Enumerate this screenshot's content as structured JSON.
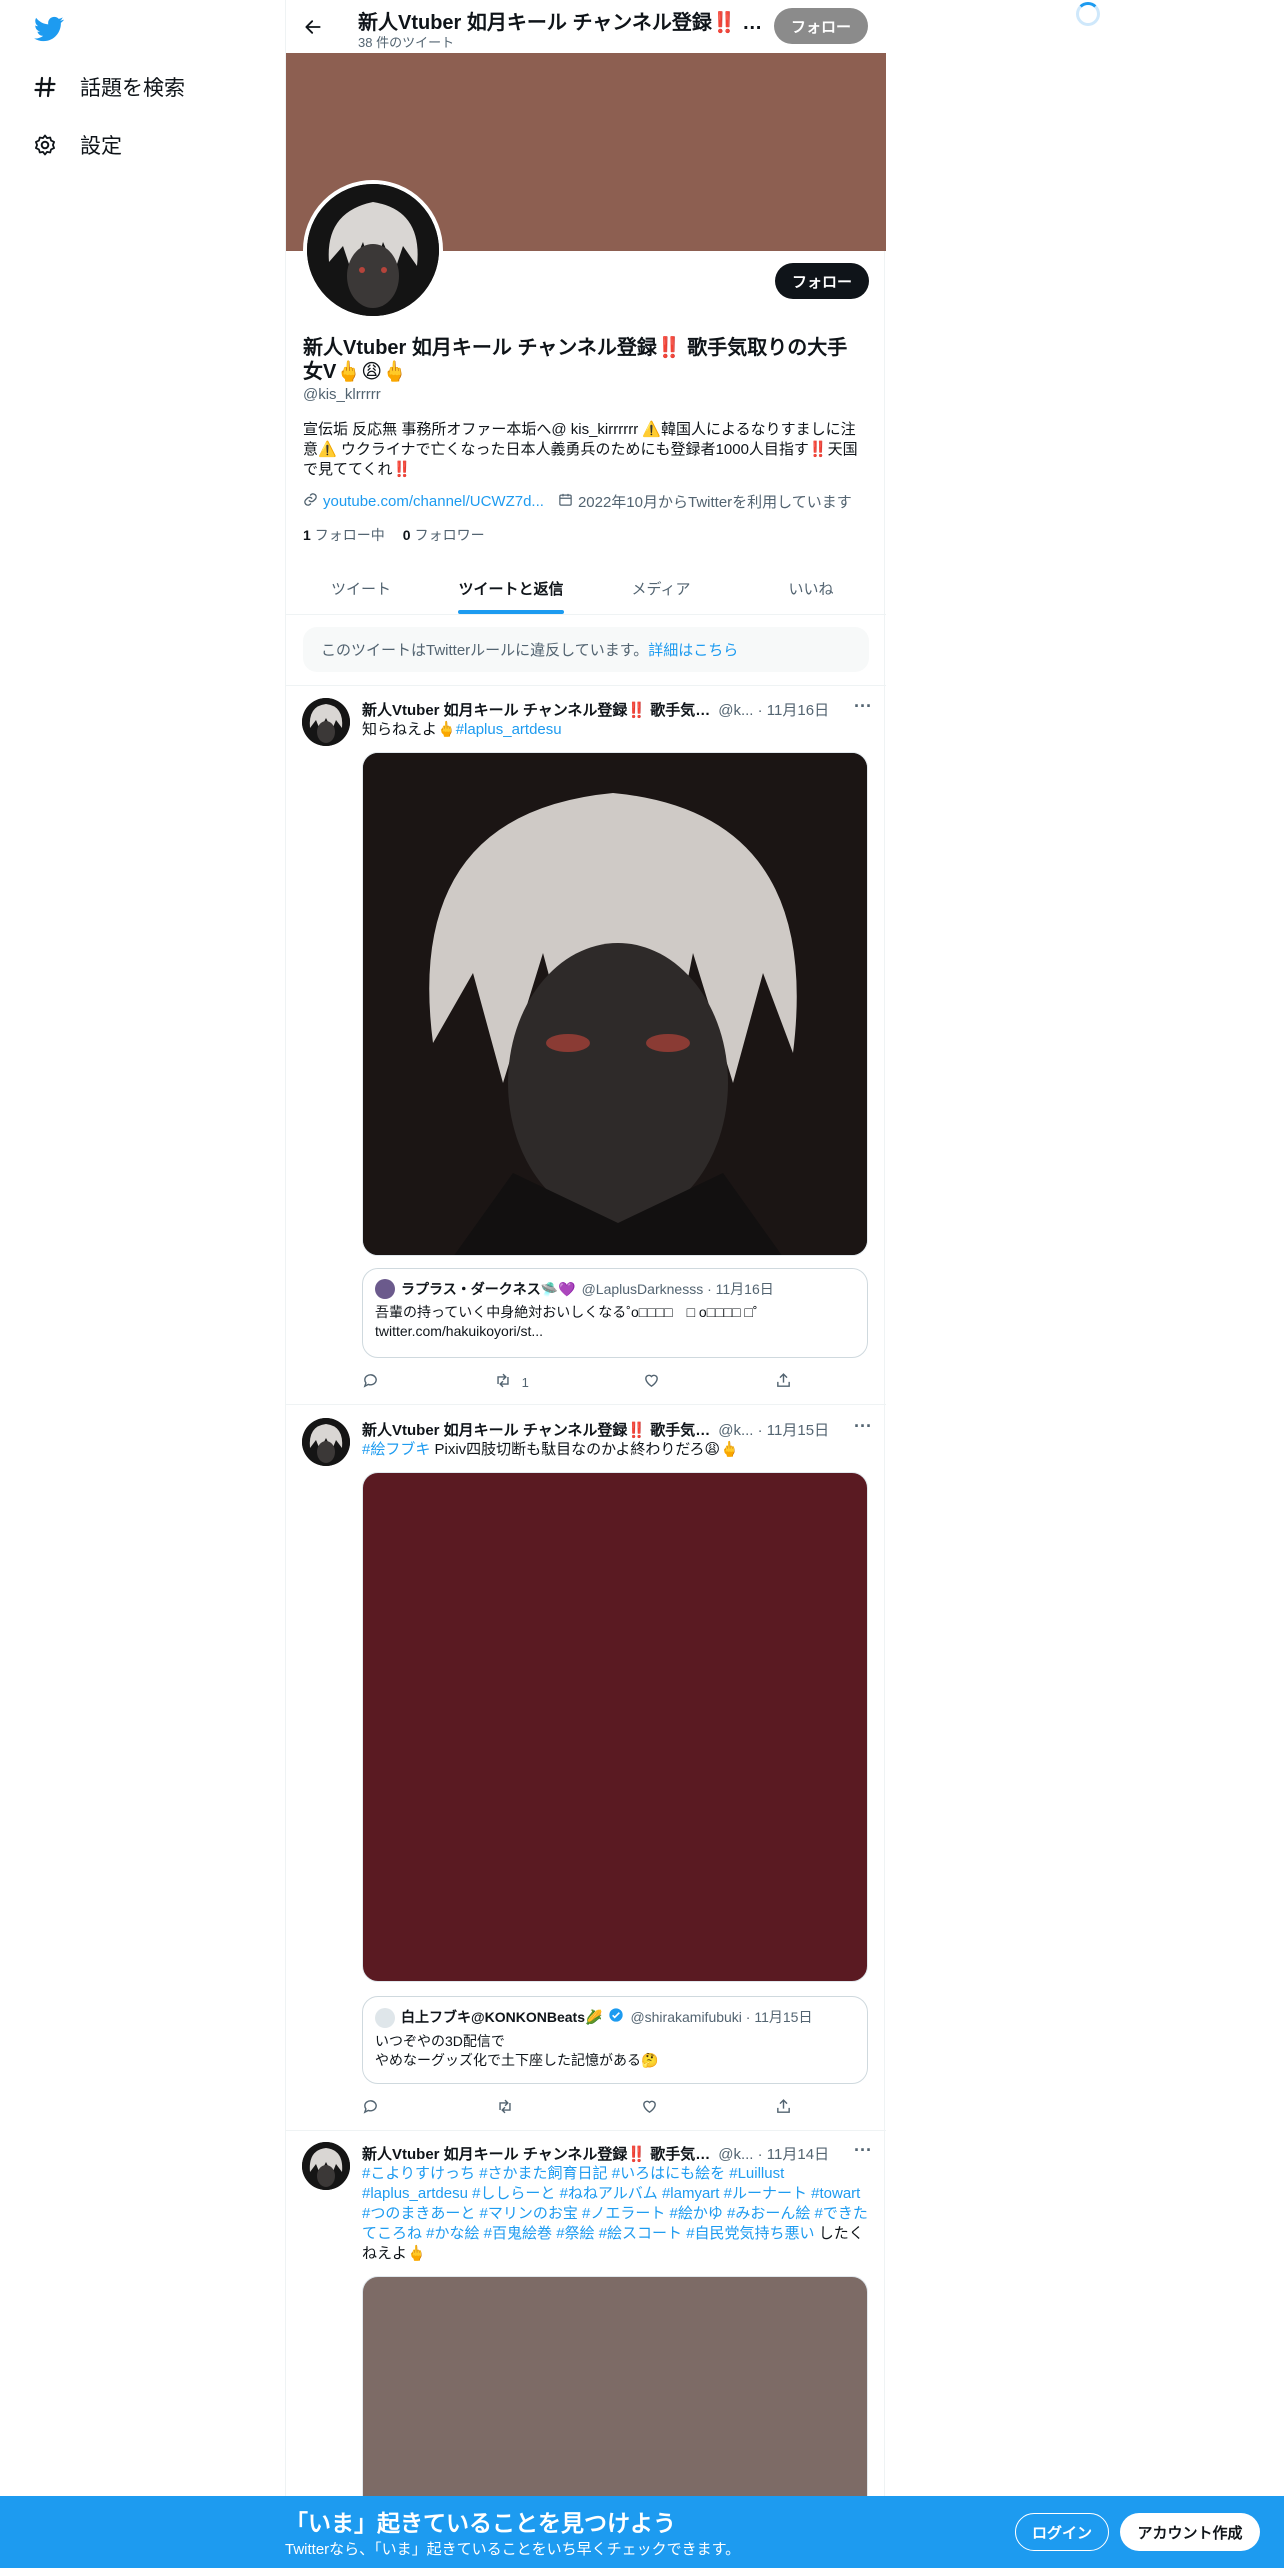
{
  "nav": {
    "items": [
      {
        "label": "話題を検索",
        "icon": "hashtag-icon"
      },
      {
        "label": "設定",
        "icon": "gear-icon"
      }
    ]
  },
  "header": {
    "title": "新人Vtuber 如月キール チャンネル登録‼️ …",
    "tweet_count": "38 件のツイート",
    "follow_label": "フォロー"
  },
  "profile": {
    "name": "新人Vtuber 如月キール チャンネル登録‼️ 歌手気取りの大手女V🖕😩🖕",
    "handle": "@kis_klrrrrr",
    "bio": "宣伝垢 反応無 事務所オファー本垢へ@ kis_kirrrrrr ⚠️韓国人によるなりすましに注意⚠️ ウクライナで亡くなった日本人義勇兵のためにも登録者1000人目指す‼️天国で見ててくれ‼️",
    "link": "youtube.com/channel/UCWZ7d...",
    "joined": "2022年10月からTwitterを利用しています",
    "following_count": "1",
    "following_label": "フォロー中",
    "followers_count": "0",
    "followers_label": "フォロワー",
    "follow_label": "フォロー"
  },
  "tabs": [
    "ツイート",
    "ツイートと返信",
    "メディア",
    "いいね"
  ],
  "notice": {
    "text": "このツイートはTwitterルールに違反しています。",
    "link": "詳細はこちら"
  },
  "tweets": [
    {
      "name": "新人Vtuber 如月キール チャンネル登録‼️ 歌手気…",
      "meta": "@k... · 11月16日",
      "text": "知らねえよ🖕",
      "tag": "#laplus_artdesu",
      "media_color": "#1b1514",
      "quote": {
        "name": "ラプラス・ダークネス🛸💜",
        "meta": "@LaplusDarknesss · 11月16日",
        "line1": "吾輩の持っていく中身絶対おいしくなる˚o□□□□　□ o□□□□ □˚",
        "line2": "twitter.com/hakuikoyori/st..."
      },
      "retweets": "1"
    },
    {
      "name": "新人Vtuber 如月キール チャンネル登録‼️ 歌手気…",
      "meta": "@k... · 11月15日",
      "tag": "#絵フブキ",
      "text": " Pixiv四肢切断も駄目なのかよ終わりだろ😩🖕",
      "media_color": "#5a1a22",
      "quote": {
        "name": "白上フブキ@KONKONBeats🌽",
        "meta": "@shirakamifubuki · 11月15日",
        "line1": "いつぞやの3D配信で",
        "line2": "やめなーグッズ化で土下座した記憶がある🤔"
      },
      "retweets": ""
    },
    {
      "name": "新人Vtuber 如月キール チャンネル登録‼️ 歌手気…",
      "meta": "@k... · 11月14日",
      "tags": "#こよりすけっち #さかまた飼育日記 #いろはにも絵を #Luillust #laplus_artdesu #ししらーと #ねねアルバム #lamyart #ルーナート #towart #つのまきあーと #マリンのお宝 #ノエラート #絵かゆ #みおーん絵 #できたてころね #かな絵 #百鬼絵巻 #祭絵 #絵スコート #自民党気持ち悪い",
      "text": " したくねえよ🖕",
      "media_color": "#7d6b66"
    }
  ],
  "bottom": {
    "headline": "「いま」起きていることを見つけよう",
    "sub": "Twitterなら、「いま」起きていることをいち早くチェックできます。",
    "login": "ログイン",
    "signup": "アカウント作成"
  },
  "colors": {
    "accent": "#1d9bf0",
    "banner": "#8d5f51",
    "text": "#0f1419",
    "muted": "#536471"
  }
}
